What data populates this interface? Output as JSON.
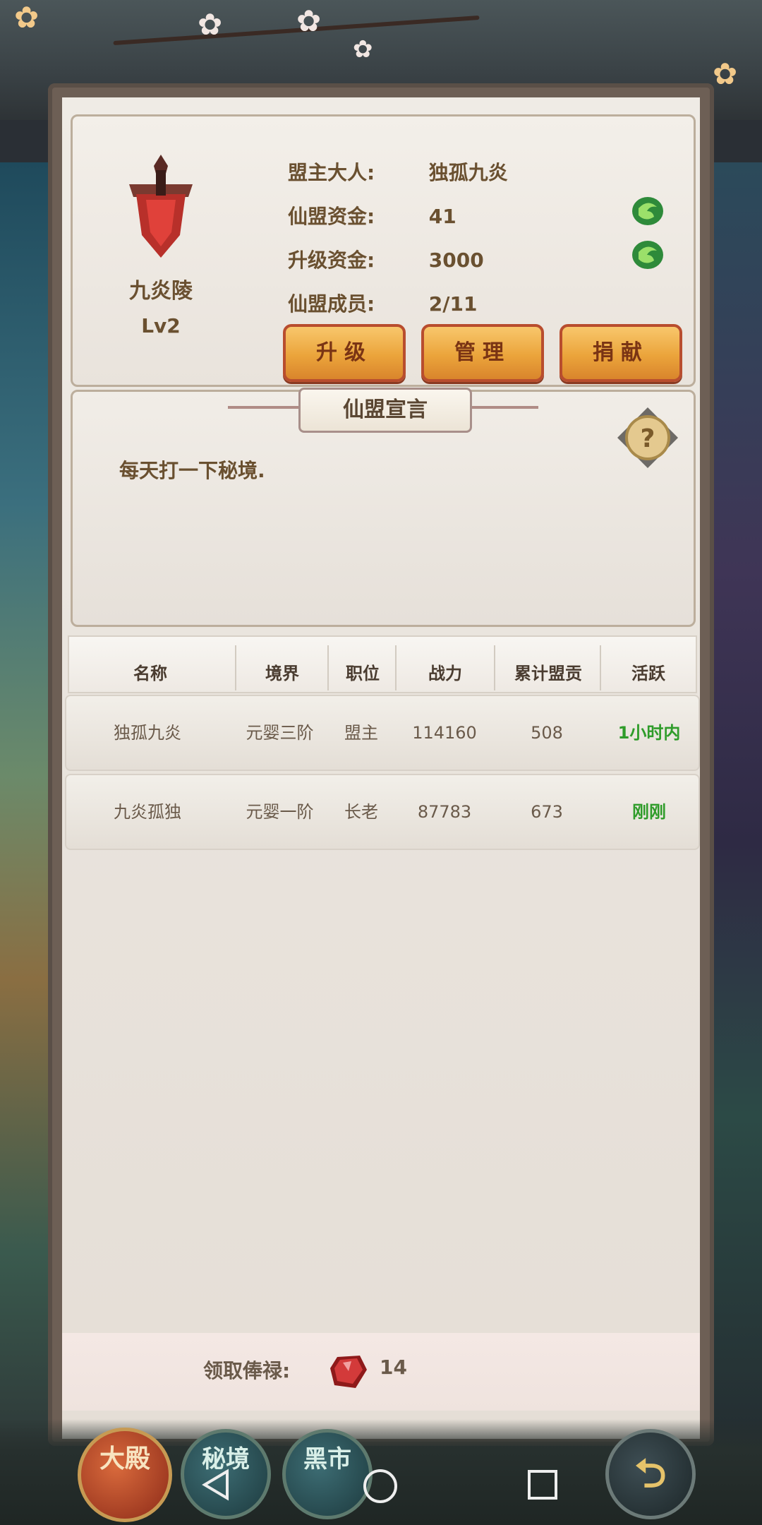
{
  "guild": {
    "name": "九炎陵",
    "level": "Lv2",
    "info": [
      {
        "label": "盟主大人:",
        "value": "独孤九炎"
      },
      {
        "label": "仙盟资金:",
        "value": "41"
      },
      {
        "label": "升级资金:",
        "value": "3000"
      },
      {
        "label": "仙盟成员:",
        "value": "2/11"
      }
    ],
    "buttons": {
      "upgrade": "升级",
      "manage": "管理",
      "donate": "捐献"
    }
  },
  "declaration": {
    "title": "仙盟宣言",
    "text": "每天打一下秘境."
  },
  "table": {
    "headers": [
      "名称",
      "境界",
      "职位",
      "战力",
      "累计盟贡",
      "活跃"
    ],
    "rows": [
      {
        "name": "独孤九炎",
        "realm": "元婴三阶",
        "position": "盟主",
        "power": "114160",
        "contribution": "508",
        "active": "1小时内"
      },
      {
        "name": "九炎孤独",
        "realm": "元婴一阶",
        "position": "长老",
        "power": "87783",
        "contribution": "673",
        "active": "刚刚"
      }
    ]
  },
  "salary": {
    "label": "领取俸禄:",
    "value": "14"
  },
  "bottom_nav": {
    "main": "大殿",
    "secret": "秘境",
    "market": "黑市"
  },
  "colors": {
    "active_green": "#2f9c2a",
    "button_orange": "#eba43b",
    "text_brown": "#6a5030"
  },
  "icons": [
    "sword-emblem-icon",
    "coin-icon",
    "help-icon",
    "gem-icon",
    "back-arrow-icon",
    "nav-back-icon",
    "nav-home-icon",
    "nav-recent-icon"
  ]
}
